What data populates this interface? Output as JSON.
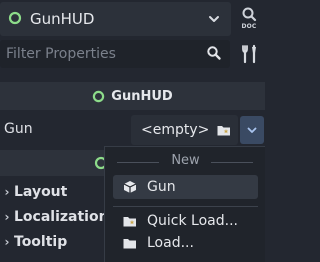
{
  "node_selector": {
    "label": "GunHUD",
    "icon": "node-circle-icon",
    "accent": "#8ddc8a"
  },
  "doc_button": {
    "label": "DOC"
  },
  "filter": {
    "placeholder": "Filter Properties"
  },
  "section": {
    "title": "GunHUD"
  },
  "property": {
    "label": "Gun",
    "value": "<empty>"
  },
  "groups": [
    {
      "label": "Layout"
    },
    {
      "label": "Localization"
    },
    {
      "label": "Tooltip"
    }
  ],
  "popup": {
    "separator_label": "New",
    "items": [
      {
        "label": "Gun",
        "icon": "cube-icon"
      },
      {
        "label": "Quick Load...",
        "icon": "quick-load-folder-icon"
      },
      {
        "label": "Load...",
        "icon": "folder-icon"
      }
    ]
  },
  "colors": {
    "accent_green": "#8ddc8a",
    "dropdown_blue": "#3a4a63",
    "panel": "#232730"
  }
}
